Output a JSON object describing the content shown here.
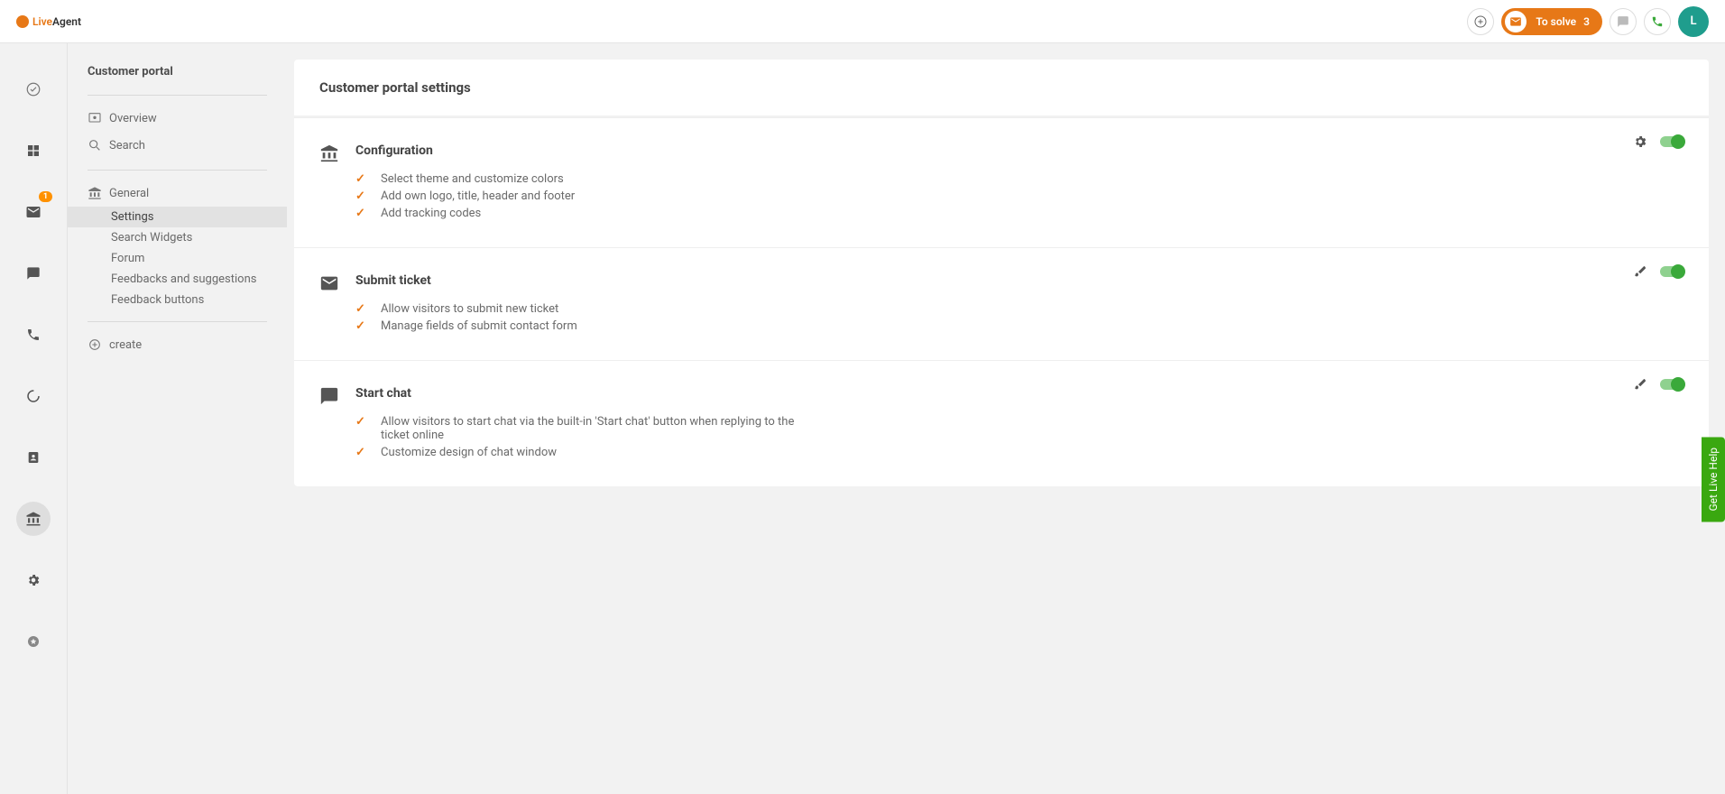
{
  "brand": {
    "name": "LiveAgent",
    "live": "Live",
    "agent": "Agent"
  },
  "header": {
    "to_solve_label": "To solve",
    "to_solve_count": "3",
    "avatar_initial": "L"
  },
  "rail": {
    "mail_badge": "1"
  },
  "sidebar": {
    "title": "Customer portal",
    "overview": "Overview",
    "search": "Search",
    "general": "General",
    "subitems": [
      "Settings",
      "Search Widgets",
      "Forum",
      "Feedbacks and suggestions",
      "Feedback buttons"
    ],
    "create": "create"
  },
  "page": {
    "title": "Customer portal settings",
    "blocks": [
      {
        "title": "Configuration",
        "items": [
          "Select theme and customize colors",
          "Add own logo, title, header and footer",
          "Add tracking codes"
        ]
      },
      {
        "title": "Submit ticket",
        "items": [
          "Allow visitors to submit new ticket",
          "Manage fields of submit contact form"
        ]
      },
      {
        "title": "Start chat",
        "items": [
          "Allow visitors to start chat via the built-in 'Start chat' button when replying to the ticket online",
          "Customize design of chat window"
        ]
      }
    ]
  },
  "live_help": "Get Live Help"
}
